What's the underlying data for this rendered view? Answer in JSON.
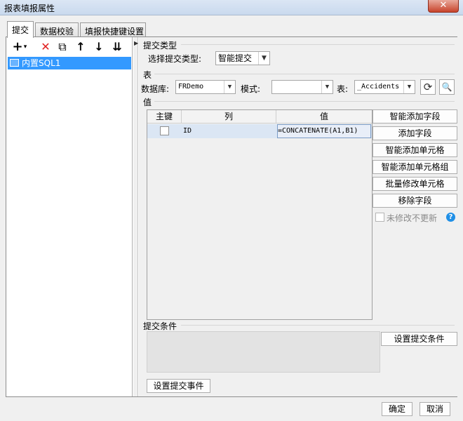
{
  "window": {
    "title": "报表填报属性",
    "close_glyph": "✕"
  },
  "tabs": [
    {
      "label": "提交",
      "active": true
    },
    {
      "label": "数据校验",
      "active": false
    },
    {
      "label": "填报快捷键设置",
      "active": false
    }
  ],
  "left_toolbar": {
    "icons": [
      "add-icon",
      "delete-icon",
      "copy-icon",
      "arrow-up-icon",
      "arrow-down-icon",
      "sort-icon"
    ],
    "glyphs": {
      "add": "+",
      "add_menu": "▾",
      "delete": "✕",
      "copy": "⧉",
      "up": "↑",
      "down": "↓",
      "sort": "⇊"
    }
  },
  "tree": {
    "items": [
      {
        "label": "内置SQL1",
        "selected": true
      }
    ]
  },
  "submit_type": {
    "section_label": "提交类型",
    "select_label": "选择提交类型:",
    "value": "智能提交"
  },
  "table_section": {
    "section_label": "表",
    "database_label": "数据库:",
    "database_value": "FRDemo",
    "mode_label": "模式:",
    "mode_value": "",
    "table_label": "表:",
    "table_value": "_Accidents"
  },
  "value_section": {
    "section_label": "值",
    "columns": [
      "主键",
      "列",
      "值"
    ],
    "rows": [
      {
        "key_checked": false,
        "column": "ID",
        "value": "=CONCATENATE(A1,B1)"
      }
    ],
    "buttons": {
      "smart_add_field": "智能添加字段",
      "add_field": "添加字段",
      "smart_add_cell": "智能添加单元格",
      "smart_add_cell_group": "智能添加单元格组",
      "batch_modify_cell": "批量修改单元格",
      "remove_field": "移除字段"
    },
    "no_update_unmodified_label": "未修改不更新",
    "no_update_unmodified_checked": false,
    "help_glyph": "?"
  },
  "submit_condition": {
    "section_label": "提交条件",
    "set_condition_button": "设置提交条件"
  },
  "set_event_button": "设置提交事件",
  "footer": {
    "ok": "确定",
    "cancel": "取消"
  },
  "colors": {
    "selection": "#3399ff",
    "row_highlight": "#dbe6f4",
    "delete_red": "#e02020",
    "close_red": "#c7432b"
  }
}
